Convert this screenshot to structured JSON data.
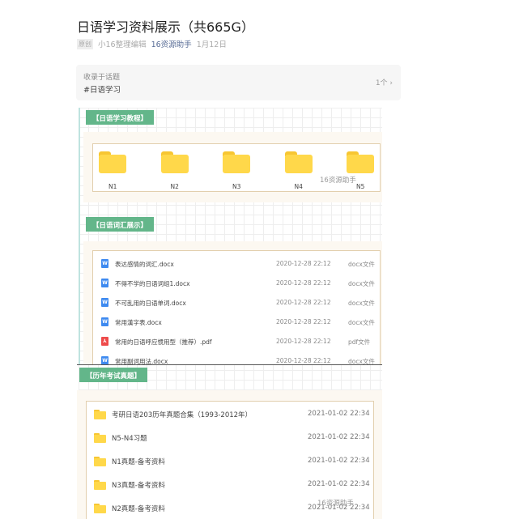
{
  "article": {
    "title": "日语学习资料展示（共665G）",
    "original_tag": "原创",
    "author": "小16整理编辑",
    "account": "16资源助手",
    "date": "1月12日"
  },
  "topic": {
    "label": "收录于话题",
    "tag": "#日语学习",
    "count": "1个 ›"
  },
  "sections": [
    {
      "title": "【日语学习教程】",
      "folders": [
        "N1",
        "N2",
        "N3",
        "N4",
        "N5"
      ]
    },
    {
      "title": "【日语词汇展示】",
      "files": [
        {
          "name": "表达感情的词汇.docx",
          "date": "2020-12-28 22:12",
          "type": "docx文件",
          "icon": "word-doc-icon"
        },
        {
          "name": "不得不学的日语词组1.docx",
          "date": "2020-12-28 22:12",
          "type": "docx文件",
          "icon": "word-doc-icon"
        },
        {
          "name": "不可乱用的日语单词.docx",
          "date": "2020-12-28 22:12",
          "type": "docx文件",
          "icon": "word-doc-icon"
        },
        {
          "name": "常用漢字表.docx",
          "date": "2020-12-28 22:12",
          "type": "docx文件",
          "icon": "word-doc-icon"
        },
        {
          "name": "常用的日语呼应惯用型（推荐）.pdf",
          "date": "2020-12-28 22:12",
          "type": "pdf文件",
          "icon": "pdf-icon"
        },
        {
          "name": "常用副词用法.docx",
          "date": "2020-12-28 22:12",
          "type": "docx文件",
          "icon": "word-doc-icon"
        }
      ]
    },
    {
      "title": "【历年考试真题】",
      "folders": [
        {
          "name": "考研日语203历年真题合集（1993-2012年）",
          "date": "2021-01-02 22:34"
        },
        {
          "name": "N5-N4习题",
          "date": "2021-01-02 22:34"
        },
        {
          "name": "N1真题-备考资料",
          "date": "2021-01-02 22:34"
        },
        {
          "name": "N3真题-备考资料",
          "date": "2021-01-02 22:34"
        },
        {
          "name": "N2真题-备考资料",
          "date": "2021-01-02 22:34"
        }
      ]
    }
  ],
  "watermark": "16资源助手"
}
